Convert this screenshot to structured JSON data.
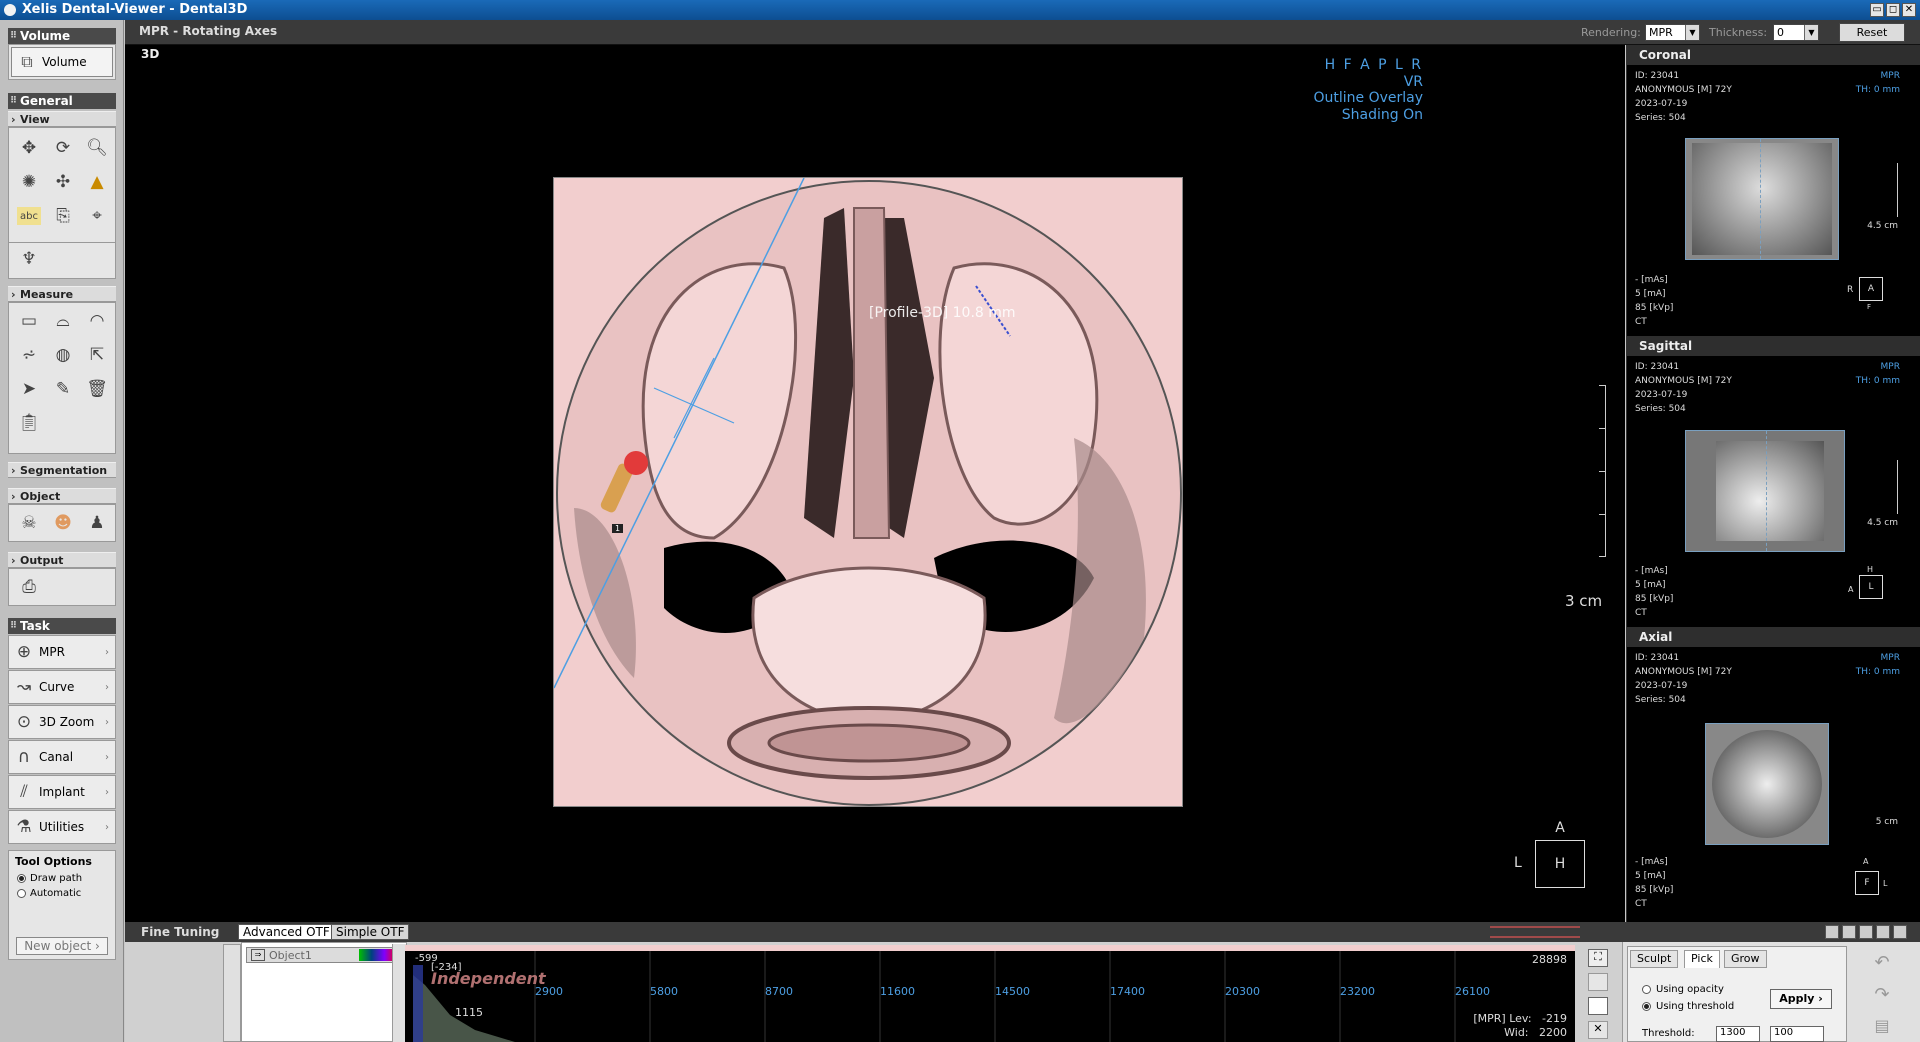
{
  "window": {
    "title": "Xelis Dental-Viewer - Dental3D",
    "controls": [
      "▭",
      "◻",
      "✕"
    ]
  },
  "sidebar": {
    "volume_section": "Volume",
    "volume_button": "Volume",
    "general_section": "General",
    "view_subsection": "View",
    "measure_subsection": "Measure",
    "segmentation_subsection": "Segmentation",
    "object_subsection": "Object",
    "output_subsection": "Output",
    "task_section": "Task",
    "tasks": [
      {
        "label": "MPR",
        "icon": "mpr-icon"
      },
      {
        "label": "Curve",
        "icon": "curve-icon"
      },
      {
        "label": "3D Zoom",
        "icon": "zoom-3d-icon"
      },
      {
        "label": "Canal",
        "icon": "canal-icon"
      },
      {
        "label": "Implant",
        "icon": "implant-icon"
      },
      {
        "label": "Utilities",
        "icon": "utilities-icon"
      }
    ],
    "tool_options": {
      "title": "Tool Options",
      "option1": "Draw path",
      "option2": "Automatic",
      "selected": "Draw path",
      "new_object_button": "New object"
    }
  },
  "viewer": {
    "header_title": "MPR - Rotating Axes",
    "rendering_label": "Rendering:",
    "rendering_value": "MPR",
    "thickness_label": "Thickness:",
    "thickness_value": "0",
    "reset_button": "Reset",
    "view_label": "3D",
    "orientation_letters": "H F A P L R",
    "render_mode": "VR",
    "outline": "Outline Overlay",
    "shading": "Shading On",
    "measurement": "[Profile-3D] 10.8 mm",
    "marker_number": "1",
    "scale_bar_label": "3 cm",
    "orientation_cube": {
      "top": "A",
      "left": "L",
      "center": "H"
    }
  },
  "right_panel": {
    "views": [
      {
        "title": "Coronal",
        "id": "ID: 23041",
        "patient": "ANONYMOUS [M] 72Y",
        "date": "2023-07-19",
        "series": "Series: 504",
        "mode": "MPR",
        "thickness": "TH: 0 mm",
        "scale": "4.5 cm",
        "mas": "- [mAs]",
        "ma": "5 [mA]",
        "kvp": "85 [kVp]",
        "modality": "CT",
        "cube_left": "R",
        "cube_center": "A",
        "cube_bottom": "F"
      },
      {
        "title": "Sagittal",
        "id": "ID: 23041",
        "patient": "ANONYMOUS [M] 72Y",
        "date": "2023-07-19",
        "series": "Series: 504",
        "mode": "MPR",
        "thickness": "TH: 0 mm",
        "scale": "4.5 cm",
        "mas": "- [mAs]",
        "ma": "5 [mA]",
        "kvp": "85 [kVp]",
        "modality": "CT",
        "cube_top": "H",
        "cube_left": "A",
        "cube_center": "L"
      },
      {
        "title": "Axial",
        "id": "ID: 23041",
        "patient": "ANONYMOUS [M] 72Y",
        "date": "2023-07-19",
        "series": "Series: 504",
        "mode": "MPR",
        "thickness": "TH: 0 mm",
        "scale": "5 cm",
        "mas": "- [mAs]",
        "ma": "5 [mA]",
        "kvp": "85 [kVp]",
        "modality": "CT",
        "cube_top": "A",
        "cube_center": "F",
        "cube_right": "L"
      }
    ]
  },
  "fine_tuning": {
    "title": "Fine Tuning",
    "tab_advanced": "Advanced OTF",
    "tab_simple": "Simple OTF",
    "object_label": "Object1",
    "graph": {
      "independent": "Independent",
      "min_value": "-599",
      "bracket_value": "[-234]",
      "left_value": "1115",
      "max_value": "28898",
      "ticks": [
        "2900",
        "5800",
        "8700",
        "11600",
        "14500",
        "17400",
        "20300",
        "23200",
        "26100"
      ],
      "level": "[MPR] Lev:   -219",
      "width": "Wid:   2200"
    },
    "sculpt_tab": "Sculpt",
    "pick_tab": "Pick",
    "grow_tab": "Grow",
    "using_opacity": "Using opacity",
    "using_threshold": "Using threshold",
    "apply_button": "Apply",
    "threshold_label": "Threshold:",
    "threshold_value1": "1300",
    "threshold_value2": "100"
  },
  "colors": {
    "accent_blue": "#4d9fe3",
    "bone_pink": "#f2cece",
    "titlebar": "#1a6ab8"
  }
}
